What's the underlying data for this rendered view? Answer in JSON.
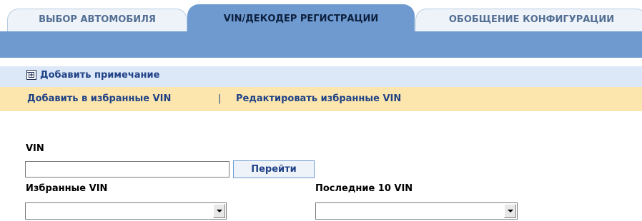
{
  "tabs": [
    {
      "label": "ВЫБОР АВТОМОБИЛЯ",
      "active": false
    },
    {
      "label": "VIN/ДЕКОДЕР РЕГИСТРАЦИИ",
      "active": true
    },
    {
      "label": "ОБОБЩЕНИЕ КОНФИГУРАЦИИ",
      "active": false
    }
  ],
  "note": {
    "label": "Добавить примечание",
    "icon": "add-note-icon"
  },
  "favorites_bar": {
    "add_label": "Добавить в избранные VIN",
    "separator": "|",
    "edit_label": "Редактировать избранные VIN"
  },
  "form": {
    "vin_label": "VIN",
    "vin_value": "",
    "go_label": "Перейти",
    "favorites_label": "Избранные VIN",
    "favorites_selected": "",
    "last_label": "Последние 10 VIN",
    "last_selected": ""
  },
  "colors": {
    "active_tab": "#6e9ad0",
    "band": "#6e9ad0",
    "note_row": "#dce8f8",
    "favorites_row": "#fce6ad",
    "link": "#1f4286"
  }
}
